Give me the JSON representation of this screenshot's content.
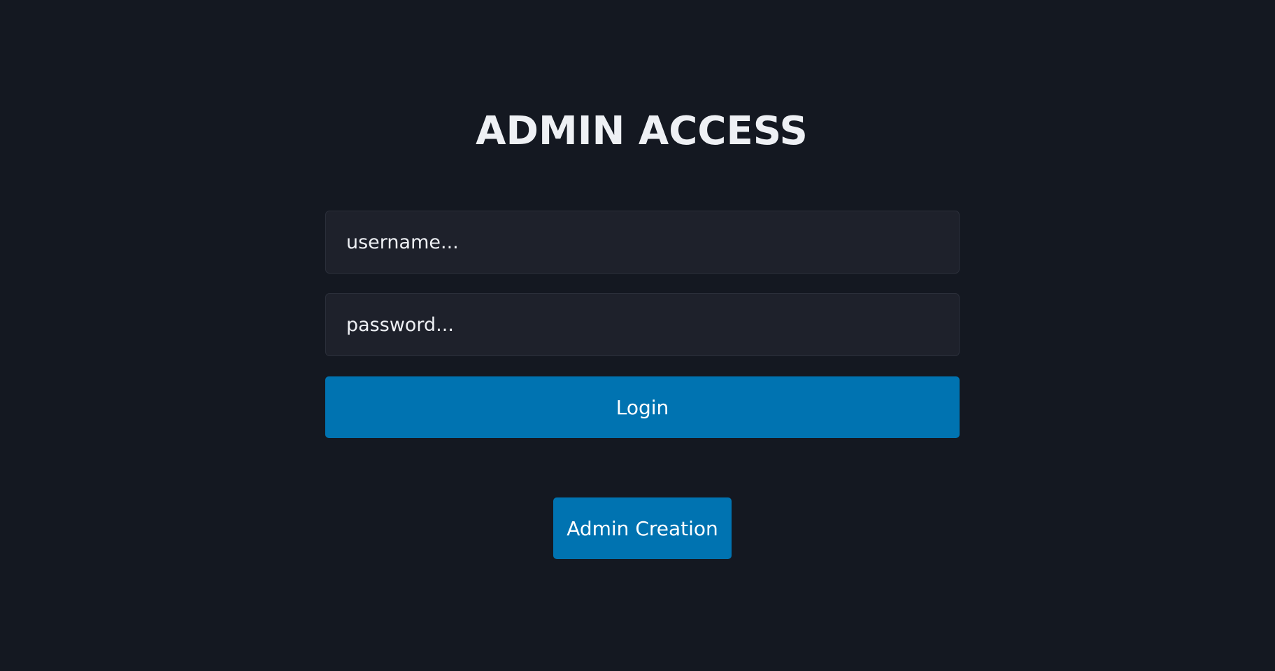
{
  "header": {
    "title": "ADMIN ACCESS"
  },
  "login_form": {
    "username": {
      "placeholder": "username...",
      "value": ""
    },
    "password": {
      "placeholder": "password...",
      "value": ""
    },
    "login_label": "Login"
  },
  "admin_creation": {
    "label": "Admin Creation"
  },
  "colors": {
    "background": "#141821",
    "field_background": "#1e212b",
    "accent": "#0073b1",
    "text": "#eef0f4"
  }
}
